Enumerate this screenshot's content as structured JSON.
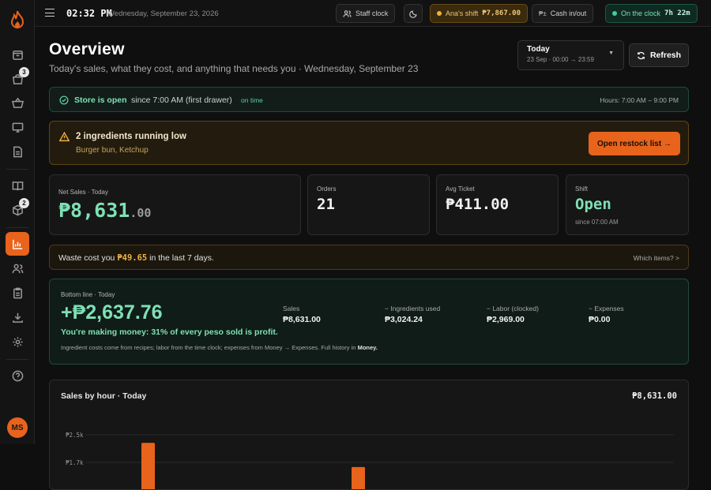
{
  "topbar": {
    "time": "02:32 PM",
    "date": "Wednesday, September 23, 2026",
    "staff_clock": "Staff clock",
    "shift_label": "Ana's shift",
    "shift_amount": "₱7,867.00",
    "cash_symbol": "₱±",
    "cash_label": "Cash in/out",
    "clock_label": "On the clock",
    "clock_duration": "7h 22m"
  },
  "sidebar": {
    "badges": {
      "orders": "3",
      "inventory": "2"
    },
    "avatar": "MS"
  },
  "header": {
    "title": "Overview",
    "subtitle": "Today's sales, what they cost, and anything that needs you · Wednesday, September 23",
    "range_title": "Today",
    "range_sub": "23 Sep · 00:00 → 23:59",
    "refresh": "Refresh"
  },
  "store": {
    "status": "Store is open",
    "since": "since 7:00 AM (first drawer)",
    "punctual": "on time",
    "hours": "Hours: 7:00 AM – 9:00 PM"
  },
  "low_stock": {
    "title": "2 ingredients running low",
    "items": "Burger bun, Ketchup",
    "button": "Open restock list →"
  },
  "kpis": {
    "net_sales_label": "Net Sales · Today",
    "net_sales_main": "₱8,631",
    "net_sales_cents": ".00",
    "orders_label": "Orders",
    "orders_value": "21",
    "avg_label": "Avg Ticket",
    "avg_value": "₱411.00",
    "shift_label": "Shift",
    "shift_value": "Open",
    "shift_sub": "since 07:00 AM"
  },
  "waste": {
    "prefix": "Waste cost you",
    "amount": "₱49.65",
    "suffix": "in the last 7 days.",
    "link": "Which items? >"
  },
  "bottom_line": {
    "label": "Bottom line · Today",
    "value": "+₱2,637.76",
    "message": "You're making money: 31% of every peso sold is profit.",
    "note_prefix": "Ingredient costs come from recipes; labor from the time clock; expenses from Money → Expenses. Full history in",
    "note_link": "Money.",
    "columns": [
      {
        "label": "Sales",
        "value": "₱8,631.00"
      },
      {
        "label": "− Ingredients used",
        "value": "₱3,024.24"
      },
      {
        "label": "− Labor (clocked)",
        "value": "₱2,969.00"
      },
      {
        "label": "− Expenses",
        "value": "₱0.00"
      }
    ]
  },
  "sales_chart": {
    "title": "Sales by hour · Today",
    "total": "₱8,631.00"
  },
  "chart_data": {
    "type": "bar",
    "title": "Sales by hour · Today",
    "y_ticks": [
      "₱2.5k",
      "₱1.7k"
    ],
    "ylim": [
      0,
      2500
    ],
    "visible_bars": [
      {
        "position": "early",
        "value": 2450
      },
      {
        "position": "midday",
        "value": 1750
      }
    ],
    "color": "#e8631c"
  },
  "colors": {
    "accent": "#e8631c",
    "positive": "#7fe0b6",
    "warning": "#f0b040"
  }
}
